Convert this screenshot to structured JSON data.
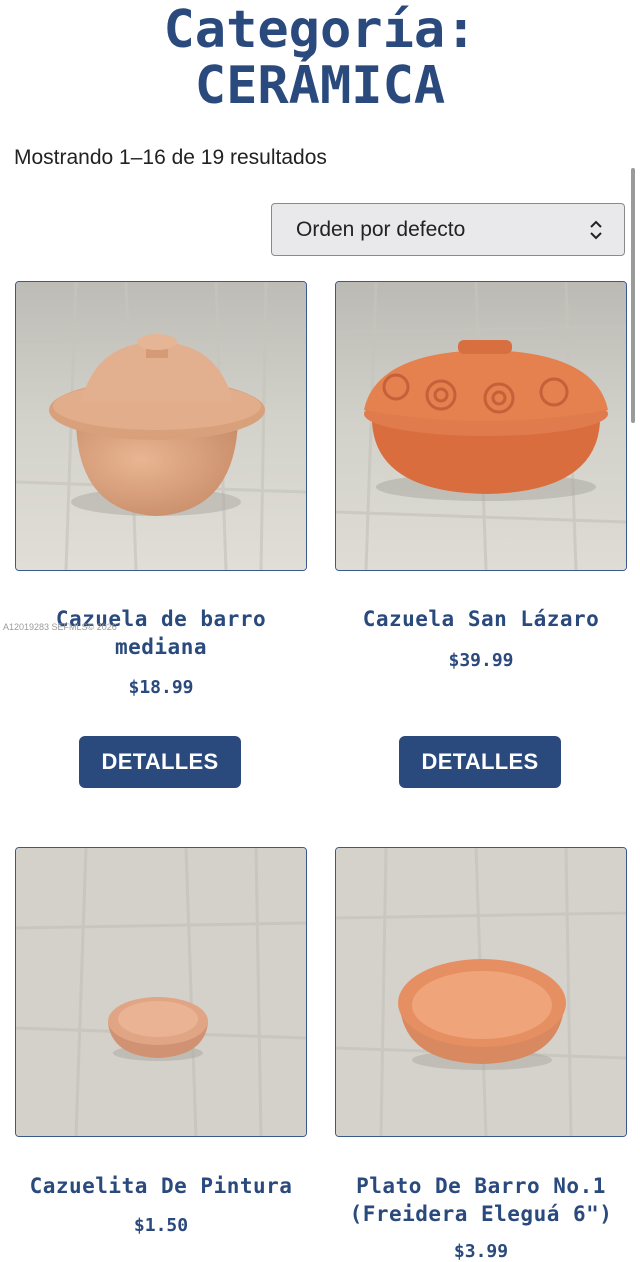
{
  "header": {
    "title_line1": "Categoría:",
    "title_line2": "CERÁMICA"
  },
  "results": {
    "count_text": "Mostrando 1–16 de 19 resultados"
  },
  "sort": {
    "selected": "Orden por defecto",
    "icon": "chevron-updown-icon"
  },
  "watermark": "A12019283 SEFMLS© 2026",
  "products": [
    {
      "name_line1": "Cazuela de barro",
      "name_line2": "mediana",
      "price": "$18.99",
      "button": "DETALLES"
    },
    {
      "name_line1": "Cazuela San Lázaro",
      "name_line2": "",
      "price": "$39.99",
      "button": "DETALLES"
    },
    {
      "name_line1": "Cazuelita De Pintura",
      "name_line2": "",
      "price": "$1.50"
    },
    {
      "name_line1": "Plato De Barro No.1",
      "name_line2": "(Freidera Eleguá 6\")",
      "price": "$3.99"
    }
  ],
  "colors": {
    "brand_blue": "#2a4a7d",
    "clay_light": "#d9a07c",
    "clay_orange": "#e07b4d"
  }
}
